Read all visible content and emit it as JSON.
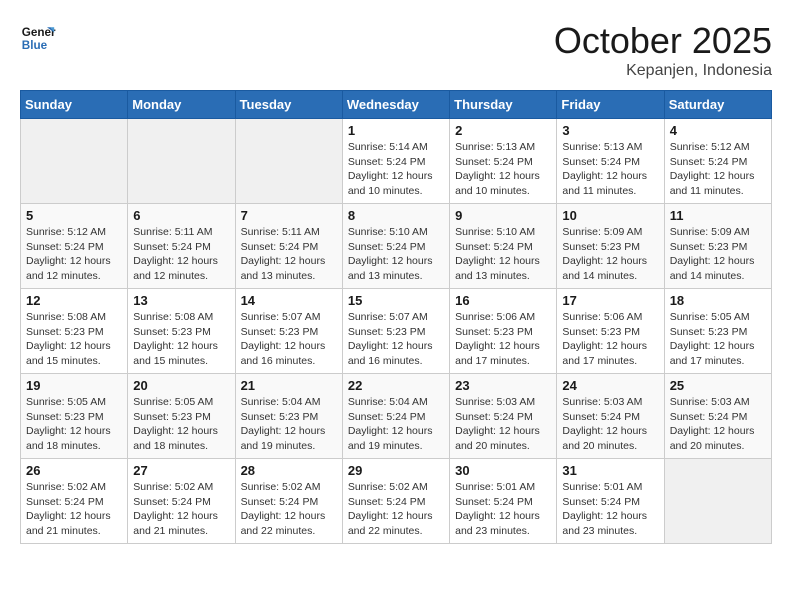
{
  "logo": {
    "line1": "General",
    "line2": "Blue"
  },
  "title": "October 2025",
  "location": "Kepanjen, Indonesia",
  "weekdays": [
    "Sunday",
    "Monday",
    "Tuesday",
    "Wednesday",
    "Thursday",
    "Friday",
    "Saturday"
  ],
  "weeks": [
    [
      {
        "day": "",
        "info": ""
      },
      {
        "day": "",
        "info": ""
      },
      {
        "day": "",
        "info": ""
      },
      {
        "day": "1",
        "info": "Sunrise: 5:14 AM\nSunset: 5:24 PM\nDaylight: 12 hours\nand 10 minutes."
      },
      {
        "day": "2",
        "info": "Sunrise: 5:13 AM\nSunset: 5:24 PM\nDaylight: 12 hours\nand 10 minutes."
      },
      {
        "day": "3",
        "info": "Sunrise: 5:13 AM\nSunset: 5:24 PM\nDaylight: 12 hours\nand 11 minutes."
      },
      {
        "day": "4",
        "info": "Sunrise: 5:12 AM\nSunset: 5:24 PM\nDaylight: 12 hours\nand 11 minutes."
      }
    ],
    [
      {
        "day": "5",
        "info": "Sunrise: 5:12 AM\nSunset: 5:24 PM\nDaylight: 12 hours\nand 12 minutes."
      },
      {
        "day": "6",
        "info": "Sunrise: 5:11 AM\nSunset: 5:24 PM\nDaylight: 12 hours\nand 12 minutes."
      },
      {
        "day": "7",
        "info": "Sunrise: 5:11 AM\nSunset: 5:24 PM\nDaylight: 12 hours\nand 13 minutes."
      },
      {
        "day": "8",
        "info": "Sunrise: 5:10 AM\nSunset: 5:24 PM\nDaylight: 12 hours\nand 13 minutes."
      },
      {
        "day": "9",
        "info": "Sunrise: 5:10 AM\nSunset: 5:24 PM\nDaylight: 12 hours\nand 13 minutes."
      },
      {
        "day": "10",
        "info": "Sunrise: 5:09 AM\nSunset: 5:23 PM\nDaylight: 12 hours\nand 14 minutes."
      },
      {
        "day": "11",
        "info": "Sunrise: 5:09 AM\nSunset: 5:23 PM\nDaylight: 12 hours\nand 14 minutes."
      }
    ],
    [
      {
        "day": "12",
        "info": "Sunrise: 5:08 AM\nSunset: 5:23 PM\nDaylight: 12 hours\nand 15 minutes."
      },
      {
        "day": "13",
        "info": "Sunrise: 5:08 AM\nSunset: 5:23 PM\nDaylight: 12 hours\nand 15 minutes."
      },
      {
        "day": "14",
        "info": "Sunrise: 5:07 AM\nSunset: 5:23 PM\nDaylight: 12 hours\nand 16 minutes."
      },
      {
        "day": "15",
        "info": "Sunrise: 5:07 AM\nSunset: 5:23 PM\nDaylight: 12 hours\nand 16 minutes."
      },
      {
        "day": "16",
        "info": "Sunrise: 5:06 AM\nSunset: 5:23 PM\nDaylight: 12 hours\nand 17 minutes."
      },
      {
        "day": "17",
        "info": "Sunrise: 5:06 AM\nSunset: 5:23 PM\nDaylight: 12 hours\nand 17 minutes."
      },
      {
        "day": "18",
        "info": "Sunrise: 5:05 AM\nSunset: 5:23 PM\nDaylight: 12 hours\nand 17 minutes."
      }
    ],
    [
      {
        "day": "19",
        "info": "Sunrise: 5:05 AM\nSunset: 5:23 PM\nDaylight: 12 hours\nand 18 minutes."
      },
      {
        "day": "20",
        "info": "Sunrise: 5:05 AM\nSunset: 5:23 PM\nDaylight: 12 hours\nand 18 minutes."
      },
      {
        "day": "21",
        "info": "Sunrise: 5:04 AM\nSunset: 5:23 PM\nDaylight: 12 hours\nand 19 minutes."
      },
      {
        "day": "22",
        "info": "Sunrise: 5:04 AM\nSunset: 5:24 PM\nDaylight: 12 hours\nand 19 minutes."
      },
      {
        "day": "23",
        "info": "Sunrise: 5:03 AM\nSunset: 5:24 PM\nDaylight: 12 hours\nand 20 minutes."
      },
      {
        "day": "24",
        "info": "Sunrise: 5:03 AM\nSunset: 5:24 PM\nDaylight: 12 hours\nand 20 minutes."
      },
      {
        "day": "25",
        "info": "Sunrise: 5:03 AM\nSunset: 5:24 PM\nDaylight: 12 hours\nand 20 minutes."
      }
    ],
    [
      {
        "day": "26",
        "info": "Sunrise: 5:02 AM\nSunset: 5:24 PM\nDaylight: 12 hours\nand 21 minutes."
      },
      {
        "day": "27",
        "info": "Sunrise: 5:02 AM\nSunset: 5:24 PM\nDaylight: 12 hours\nand 21 minutes."
      },
      {
        "day": "28",
        "info": "Sunrise: 5:02 AM\nSunset: 5:24 PM\nDaylight: 12 hours\nand 22 minutes."
      },
      {
        "day": "29",
        "info": "Sunrise: 5:02 AM\nSunset: 5:24 PM\nDaylight: 12 hours\nand 22 minutes."
      },
      {
        "day": "30",
        "info": "Sunrise: 5:01 AM\nSunset: 5:24 PM\nDaylight: 12 hours\nand 23 minutes."
      },
      {
        "day": "31",
        "info": "Sunrise: 5:01 AM\nSunset: 5:24 PM\nDaylight: 12 hours\nand 23 minutes."
      },
      {
        "day": "",
        "info": ""
      }
    ]
  ]
}
